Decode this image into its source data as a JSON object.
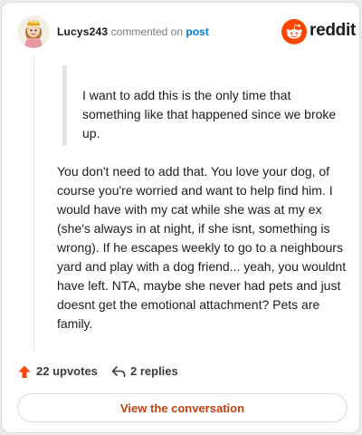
{
  "header": {
    "username": "Lucys243",
    "action_text": "commented on",
    "post_link_label": "post",
    "brand_name": "reddit"
  },
  "quote": {
    "text": "I want to add this is the only time that something like that happened since we broke up."
  },
  "comment": {
    "body": "You don't need to add that. You love your dog, of course you're worried and want to help find him. I would have with my cat while she was at my ex (she's always in at night, if she isnt, something is wrong). If he escapes weekly to go to a neighbours yard and play with a dog friend... yeah, you wouldnt have left. NTA, maybe she never had pets and just doesnt get the emotional attachment? Pets are family."
  },
  "footer": {
    "upvotes_label": "22 upvotes",
    "replies_label": "2 replies",
    "cta_label": "View the conversation"
  },
  "colors": {
    "upvote": "#ff4500",
    "link": "#0079d3",
    "cta_text": "#c24012",
    "brand": "#ff4500"
  },
  "icons": {
    "avatar": "snoo-avatar-icon",
    "brand": "reddit-logo-icon",
    "upvote": "upvote-arrow-icon",
    "reply": "reply-arrow-icon"
  }
}
